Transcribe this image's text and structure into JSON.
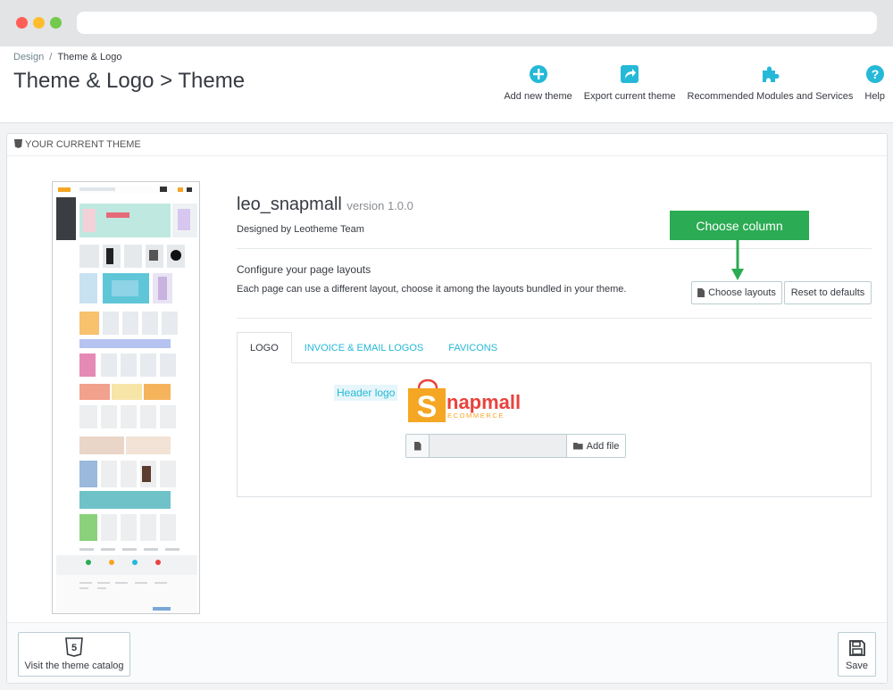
{
  "breadcrumb": {
    "parent": "Design",
    "separator": "/",
    "current": "Theme & Logo"
  },
  "page_title": "Theme & Logo > Theme",
  "toolbar": {
    "add_theme": "Add new theme",
    "export_theme": "Export current theme",
    "recommended": "Recommended Modules and Services",
    "help": "Help"
  },
  "panel": {
    "heading": "YOUR CURRENT THEME"
  },
  "theme": {
    "name": "leo_snapmall",
    "version": "version 1.0.0",
    "designed_by": "Designed by Leotheme Team"
  },
  "layouts": {
    "title": "Configure your page layouts",
    "description": "Each page can use a different layout, choose it among the layouts bundled in your theme.",
    "choose_button": "Choose layouts",
    "reset_button": "Reset to defaults"
  },
  "callout": "Choose column",
  "tabs": [
    {
      "label": "LOGO",
      "active": true
    },
    {
      "label": "INVOICE & EMAIL LOGOS",
      "active": false
    },
    {
      "label": "FAVICONS",
      "active": false
    }
  ],
  "logo_tab": {
    "header_logo_label": "Header logo",
    "logo_text": "napmall",
    "logo_initial": "S",
    "logo_sub": "ECOMMERCE",
    "add_file": "Add file"
  },
  "footer": {
    "catalog_button": "Visit the theme catalog",
    "save_button": "Save"
  },
  "colors": {
    "accent": "#25b9d7",
    "callout": "#2bab53",
    "logo_orange": "#f5a623",
    "logo_red": "#e8433d"
  }
}
